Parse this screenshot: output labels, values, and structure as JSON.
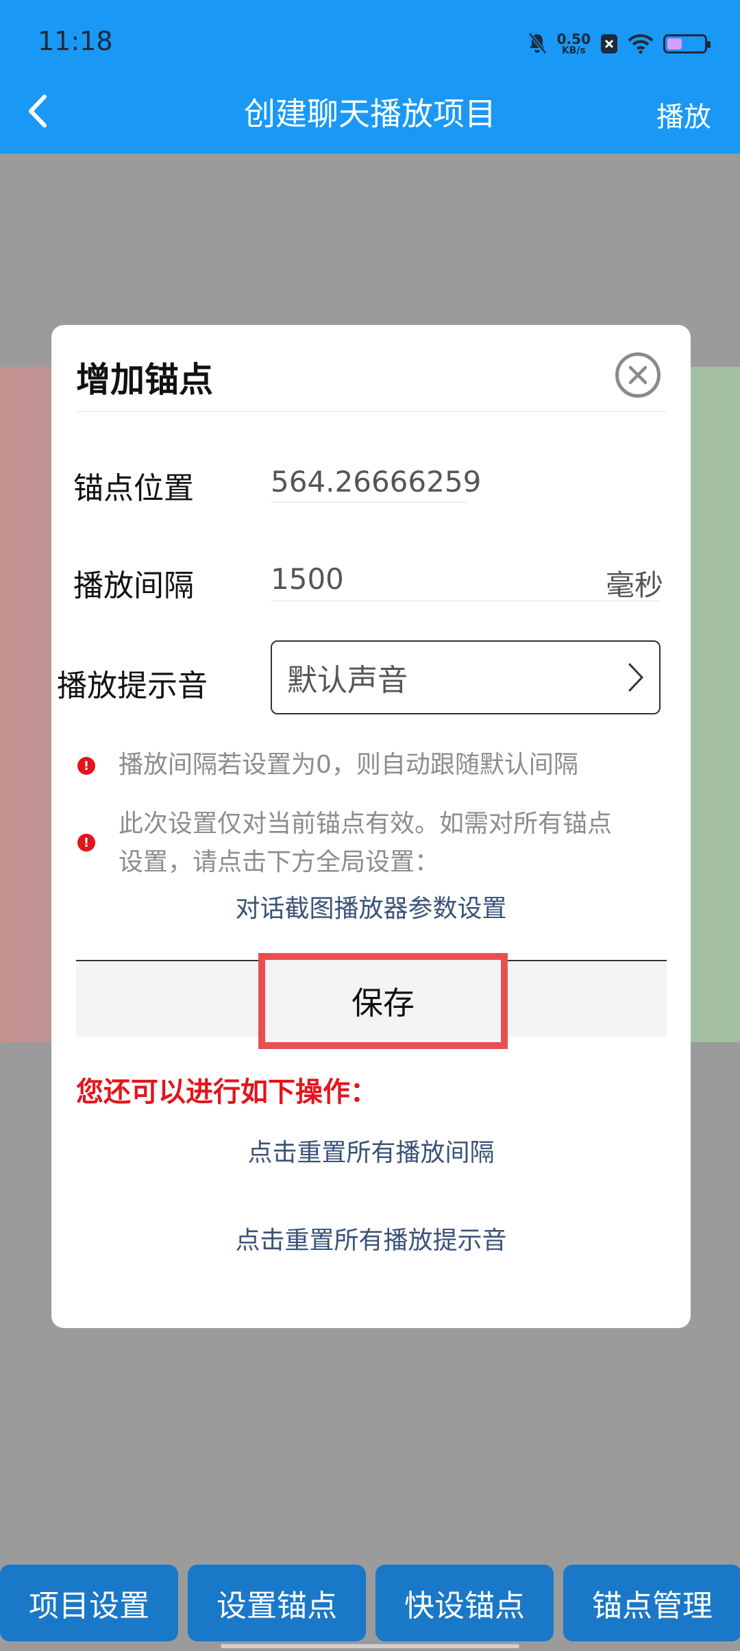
{
  "status_bar": {
    "time": "11:18",
    "net_speed_value": "0.50",
    "net_speed_unit": "KB/s",
    "icons": [
      "mute-bell-icon",
      "x-badge-icon",
      "wifi-icon",
      "battery-icon"
    ]
  },
  "header": {
    "title": "创建聊天播放项目",
    "back_icon": "chevron-left-icon",
    "action_label": "播放"
  },
  "dialog": {
    "title": "增加锚点",
    "close_icon": "close-circle-icon",
    "anchor_position_label": "锚点位置",
    "anchor_position_value": "564.26666259",
    "play_interval_label": "播放间隔",
    "play_interval_value": "1500",
    "play_interval_unit": "毫秒",
    "tone_label": "播放提示音",
    "tone_value": "默认声音",
    "note_1": "播放间隔若设置为0，则自动跟随默认间隔",
    "note_2_line1": "此次设置仅对当前锚点有效。如需对所有锚点",
    "note_2_line2": "设置，请点击下方全局设置：",
    "global_settings_link": "对话截图播放器参数设置",
    "save_label": "保存",
    "more_ops_heading": "您还可以进行如下操作：",
    "reset_intervals_link": "点击重置所有播放间隔",
    "reset_tones_link": "点击重置所有播放提示音"
  },
  "bottom_buttons": [
    {
      "label": "项目设置"
    },
    {
      "label": "设置锚点"
    },
    {
      "label": "快设锚点"
    },
    {
      "label": "锚点管理"
    }
  ],
  "colors": {
    "header_blue": "#1a98f6",
    "bottom_button_blue": "#1a78c8",
    "highlight_red": "#e85050",
    "warning_red": "#e3141c",
    "link_blue": "#3b5278"
  }
}
